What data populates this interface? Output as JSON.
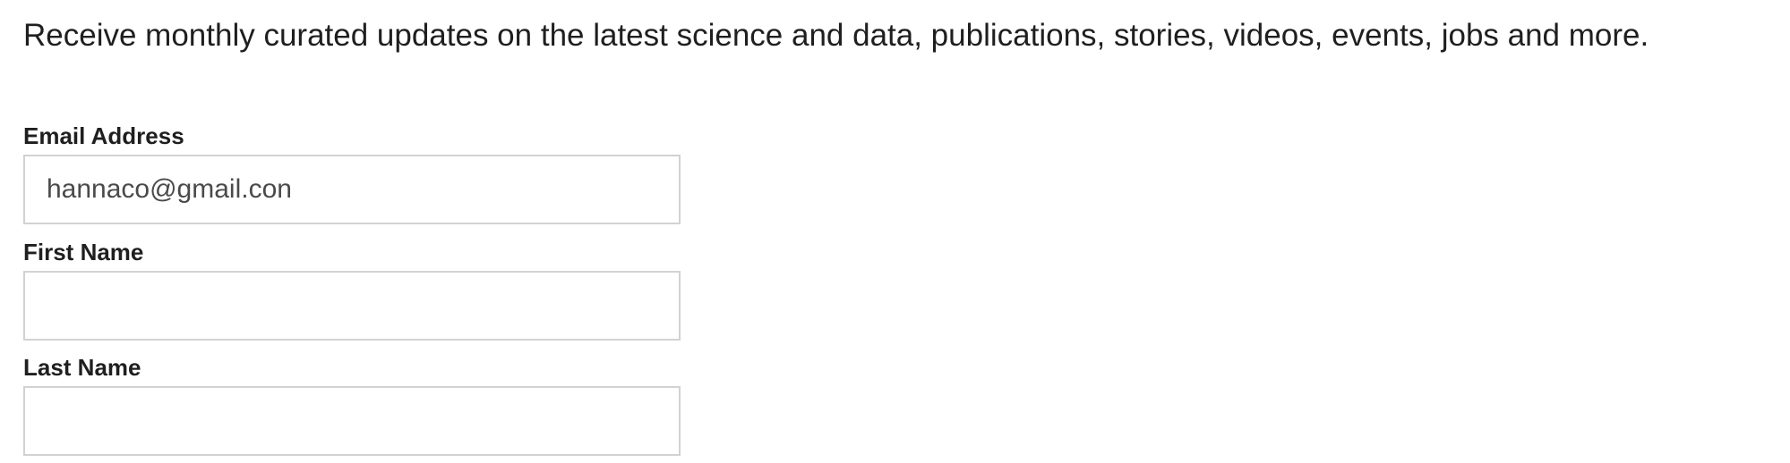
{
  "intro": {
    "text": "Receive monthly curated updates on the latest science and data, publications, stories, videos, events, jobs and more."
  },
  "form": {
    "email": {
      "label": "Email Address",
      "value": "hannaco@gmail.con",
      "placeholder": ""
    },
    "first_name": {
      "label": "First Name",
      "value": "",
      "placeholder": ""
    },
    "last_name": {
      "label": "Last Name",
      "value": "",
      "placeholder": ""
    }
  }
}
